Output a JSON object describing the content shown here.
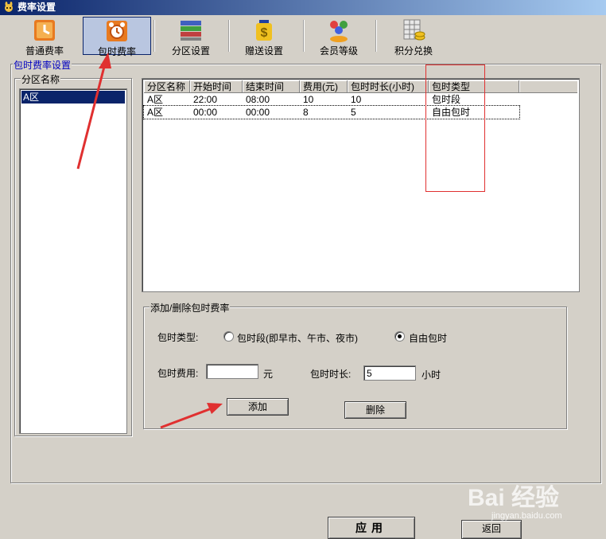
{
  "window": {
    "title": "费率设置"
  },
  "toolbar": {
    "items": [
      {
        "label": "普通费率",
        "icon": "clock-icon"
      },
      {
        "label": "包时费率",
        "icon": "alarm-clock-icon"
      },
      {
        "label": "分区设置",
        "icon": "layers-icon"
      },
      {
        "label": "赠送设置",
        "icon": "money-bag-icon"
      },
      {
        "label": "会员等级",
        "icon": "users-icon"
      },
      {
        "label": "积分兑换",
        "icon": "calculator-coins-icon"
      }
    ],
    "active_index": 1
  },
  "main": {
    "group_title": "包时费率设置",
    "zone_group_title": "分区名称",
    "zones": [
      "A区"
    ]
  },
  "grid": {
    "columns": [
      "分区名称",
      "开始时间",
      "结束时间",
      "费用(元)",
      "包时时长(小时)",
      "包时类型"
    ],
    "rows": [
      [
        "A区",
        "22:00",
        "08:00",
        "10",
        "10",
        "包时段"
      ],
      [
        "A区",
        "00:00",
        "00:00",
        "8",
        "5",
        "自由包时"
      ]
    ]
  },
  "add_panel": {
    "title": "添加/删除包时费率",
    "type_label": "包时类型:",
    "option_period": "包时段(即早市、午市、夜市)",
    "option_free": "自由包时",
    "selected": "自由包时",
    "fee_label": "包时费用:",
    "fee_value": "",
    "fee_unit": "元",
    "duration_label": "包时时长:",
    "duration_value": "5",
    "duration_unit": "小时",
    "add_button": "添加",
    "delete_button": "删除"
  },
  "footer": {
    "apply_button": "应用",
    "back_button": "返回"
  },
  "watermark": {
    "text": "Bai 经验",
    "url": "jingyan.baidu.com"
  },
  "colors": {
    "title_start": "#0a246a",
    "title_end": "#a6caf0",
    "selection": "#0a246a",
    "annotation": "#e03030"
  }
}
